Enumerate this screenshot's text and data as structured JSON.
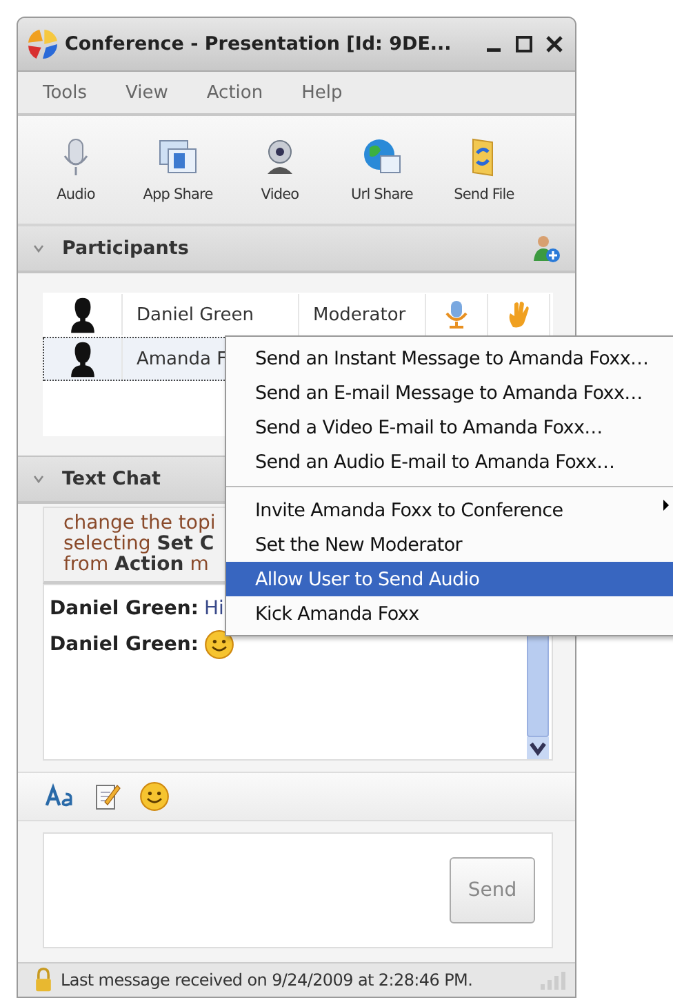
{
  "window": {
    "title": "Conference - Presentation [Id: 9DE..."
  },
  "menu": [
    {
      "label": "Tools",
      "selected": false
    },
    {
      "label": "View",
      "selected": false
    },
    {
      "label": "Action",
      "selected": false
    },
    {
      "label": "Help",
      "selected": false
    }
  ],
  "toolbar": [
    {
      "label": "Audio",
      "kind": "microphone"
    },
    {
      "label": "App Share",
      "kind": "screens"
    },
    {
      "label": "Video",
      "kind": "webcam"
    },
    {
      "label": "Url Share",
      "kind": "globe"
    },
    {
      "label": "Send File",
      "kind": "folder"
    }
  ],
  "participants": {
    "title": "Participants",
    "expanded": true,
    "rows": [
      {
        "name": "Daniel Green",
        "role": "Moderator",
        "selected": false
      },
      {
        "name": "Amanda F",
        "selected": true
      }
    ]
  },
  "context_menu": {
    "items": [
      {
        "label": "Send an Instant Message to Amanda Foxx…",
        "selected": false,
        "separator_before": false,
        "submenu": false
      },
      {
        "label": "Send an E-mail Message to Amanda Foxx…",
        "selected": false,
        "separator_before": false,
        "submenu": false
      },
      {
        "label": "Send a Video E-mail to Amanda Foxx…",
        "selected": false,
        "separator_before": false,
        "submenu": false
      },
      {
        "label": "Send an Audio E-mail to Amanda Foxx…",
        "selected": false,
        "separator_before": false,
        "submenu": false
      },
      {
        "label": "Invite Amanda Foxx to Conference",
        "selected": false,
        "separator_before": true,
        "submenu": true
      },
      {
        "label": "Set the New Moderator",
        "selected": false,
        "separator_before": false,
        "submenu": false
      },
      {
        "label": "Allow User to Send Audio",
        "selected": true,
        "separator_before": false,
        "submenu": false
      },
      {
        "label": "Kick Amanda Foxx",
        "selected": false,
        "separator_before": false,
        "submenu": false
      }
    ]
  },
  "text_chat": {
    "title": "Text Chat",
    "expanded": true,
    "topic_lines": [
      "change the topi",
      "selecting **Set C**",
      "from **Action** m"
    ],
    "messages": [
      {
        "sender": "Daniel Green:",
        "kind": "text",
        "text": "Hi"
      },
      {
        "sender": "Daniel Green:",
        "kind": "emoji"
      }
    ]
  },
  "send_button": "Send",
  "status_bar": "Last message received on 9/24/2009 at 2:28:46 PM."
}
